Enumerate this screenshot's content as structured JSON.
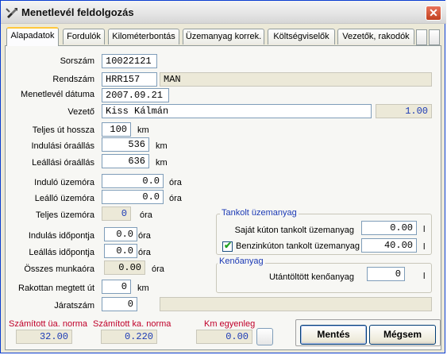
{
  "window": {
    "title": "Menetlevél feldolgozás",
    "close_symbol": "✕"
  },
  "tabs": [
    "Alapadatok",
    "Fordulók",
    "Kilométerbontás",
    "Üzemanyag korrek.",
    "Költségviselők",
    "Vezetők, rakodók"
  ],
  "form": {
    "sorszam": {
      "label": "Sorszám",
      "value": "10022121"
    },
    "rendszam": {
      "label": "Rendszám",
      "value": "HRR157",
      "make": "MAN"
    },
    "datum": {
      "label": "Menetlevél dátuma",
      "value": "2007.09.21"
    },
    "vezeto": {
      "label": "Vezető",
      "value": "Kiss Kálmán",
      "ratio": "1.00"
    },
    "teljes_ut": {
      "label": "Teljes út hossza",
      "value": "100",
      "unit": "km"
    },
    "indulasi_ora": {
      "label": "Indulási óraállás",
      "value": "536",
      "unit": "km"
    },
    "leallasi_ora": {
      "label": "Leállási óraállás",
      "value": "636",
      "unit": "km"
    },
    "indulo_uzemora": {
      "label": "Induló üzemóra",
      "value": "0.0",
      "unit": "óra"
    },
    "leallo_uzemora": {
      "label": "Leálló üzemóra",
      "value": "0.0",
      "unit": "óra"
    },
    "teljes_uzemora": {
      "label": "Teljes üzemóra",
      "value": "0",
      "unit": "óra"
    },
    "indulas_idopont": {
      "label": "Indulás időpontja",
      "value": "0.0",
      "unit": "óra"
    },
    "leallas_idopont": {
      "label": "Leállás időpontja",
      "value": "0.0",
      "unit": "óra"
    },
    "osszes_munkaora": {
      "label": "Összes munkaóra",
      "value": "0.00",
      "unit": "óra"
    },
    "rakottan_ut": {
      "label": "Rakottan megtett út",
      "value": "0",
      "unit": "km"
    },
    "jaratszam": {
      "label": "Járatszám",
      "value": "0"
    }
  },
  "tankolt": {
    "title": "Tankolt üzemanyag",
    "sajat": {
      "label": "Saját kúton tankolt üzemanyag",
      "value": "0.00",
      "unit": "l"
    },
    "benzinkut": {
      "label": "Benzinkúton tankolt üzemanyag",
      "value": "40.00",
      "unit": "l",
      "checked": true
    }
  },
  "kenoanyag": {
    "title": "Kenőanyag",
    "utantoltott": {
      "label": "Utántöltött kenőanyag",
      "value": "0",
      "unit": "l"
    }
  },
  "footer": {
    "ua_norma": {
      "label": "Számított üa. norma",
      "value": "32.00"
    },
    "ka_norma": {
      "label": "Számított ka. norma",
      "value": "0.220"
    },
    "km_egyenleg": {
      "label": "Km egyenleg",
      "value": "0.00"
    }
  },
  "buttons": {
    "save": "Mentés",
    "cancel": "Mégsem"
  },
  "colors": {
    "label_red": "#c0002a",
    "value_blue": "#1c3ab5",
    "accent_tab": "#ffc83c"
  }
}
